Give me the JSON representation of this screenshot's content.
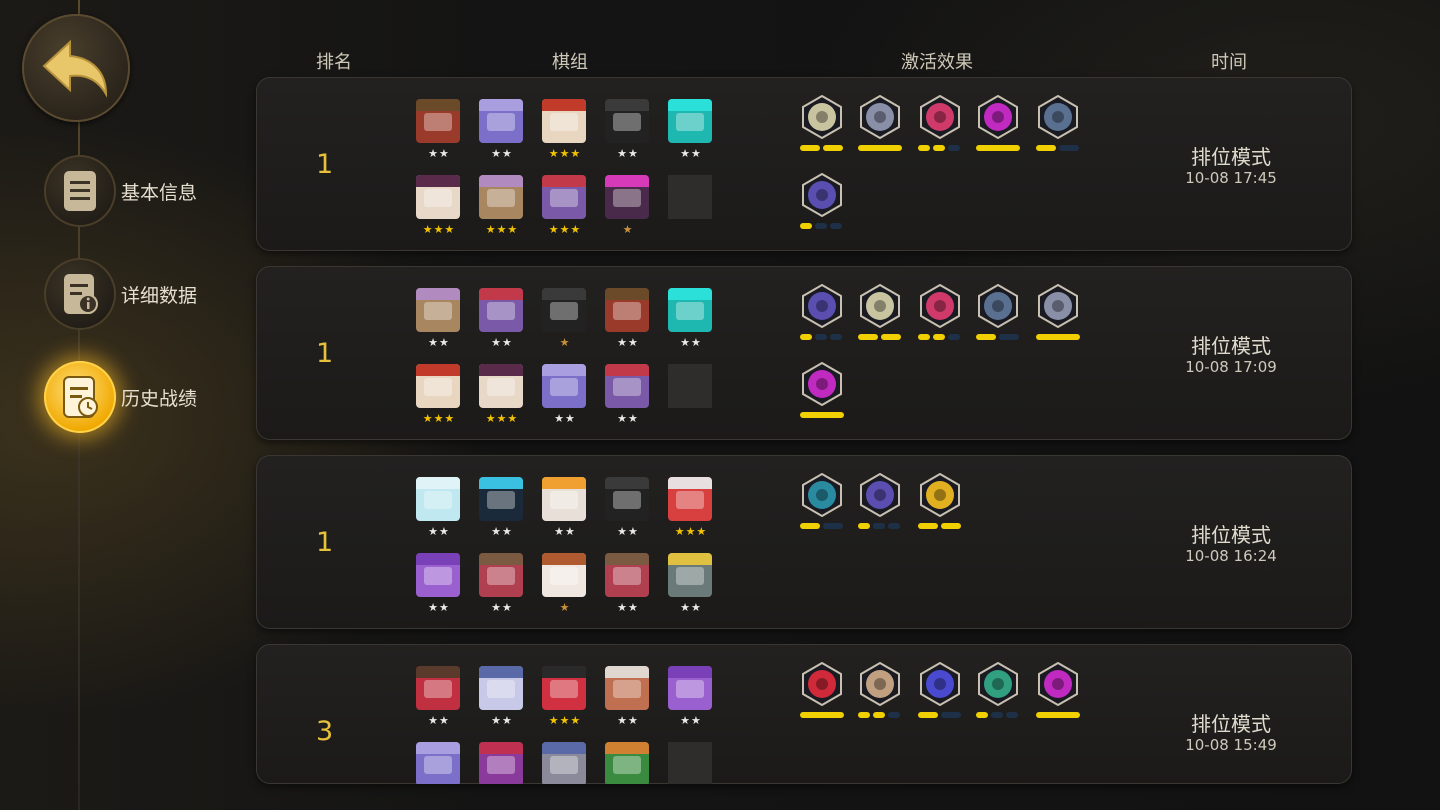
{
  "nav": {
    "items": [
      {
        "label": "基本信息",
        "icon": "document-icon",
        "active": false
      },
      {
        "label": "详细数据",
        "icon": "detail-data-icon",
        "active": false
      },
      {
        "label": "历史战绩",
        "icon": "history-record-icon",
        "active": true
      }
    ]
  },
  "headers": {
    "rank": "排名",
    "lineup": "棋组",
    "synergy": "激活效果",
    "time": "时间"
  },
  "records": [
    {
      "rank": "1",
      "mode": "排位模式",
      "time": "10-08 17:45",
      "units": [
        {
          "stars": "★★",
          "color": "#9a3a2a",
          "cap": "#6b4a2a"
        },
        {
          "stars": "★★",
          "color": "#7b6fc9",
          "cap": "#a99fe0"
        },
        {
          "stars": "★★★",
          "color": "#e8d6c0",
          "cap": "#c23a2a"
        },
        {
          "stars": "★★",
          "color": "#222222",
          "cap": "#3a3a3a"
        },
        {
          "stars": "★★",
          "color": "#1fb8b0",
          "cap": "#2ae0d8"
        },
        {
          "stars": "★★★",
          "color": "#e8d8c8",
          "cap": "#5a2a4a"
        },
        {
          "stars": "★★★",
          "color": "#a88660",
          "cap": "#b18ac0"
        },
        {
          "stars": "★★★",
          "color": "#7a5aa8",
          "cap": "#c23a4a"
        },
        {
          "stars": "★",
          "color": "#4a2a4a",
          "cap": "#d63ab8"
        },
        {
          "stars": "",
          "color": "",
          "cap": "",
          "empty": true
        }
      ],
      "synergies": [
        {
          "icon": "paw-crest-icon",
          "color": "#c9c4a0",
          "bars": [
            1,
            1
          ]
        },
        {
          "icon": "cross-icon",
          "color": "#8a8fa8",
          "bars": [
            2
          ]
        },
        {
          "icon": "knight-icon",
          "color": "#d03a6a",
          "bars": [
            1,
            1,
            0
          ]
        },
        {
          "icon": "demon-icon",
          "color": "#c02ac0",
          "bars": [
            2
          ]
        },
        {
          "icon": "scales-icon",
          "color": "#5a7090",
          "bars": [
            1,
            0
          ]
        },
        {
          "icon": "book-icon",
          "color": "#5a4fb0",
          "bars": [
            1,
            0,
            0
          ]
        }
      ]
    },
    {
      "rank": "1",
      "mode": "排位模式",
      "time": "10-08 17:09",
      "units": [
        {
          "stars": "★★",
          "color": "#a88660",
          "cap": "#b18ac0"
        },
        {
          "stars": "★★",
          "color": "#7a5aa8",
          "cap": "#c23a4a"
        },
        {
          "stars": "★",
          "color": "#222222",
          "cap": "#3a3a3a"
        },
        {
          "stars": "★★",
          "color": "#9a3a2a",
          "cap": "#6b4a2a"
        },
        {
          "stars": "★★",
          "color": "#1fb8b0",
          "cap": "#2ae0d8"
        },
        {
          "stars": "★★★",
          "color": "#e8d6c0",
          "cap": "#c23a2a"
        },
        {
          "stars": "★★★",
          "color": "#e8d8c8",
          "cap": "#5a2a4a"
        },
        {
          "stars": "★★",
          "color": "#7b6fc9",
          "cap": "#a99fe0"
        },
        {
          "stars": "★★",
          "color": "#7a5aa8",
          "cap": "#c23a4a"
        },
        {
          "stars": "",
          "color": "",
          "cap": "",
          "empty": true
        }
      ],
      "synergies": [
        {
          "icon": "book-icon",
          "color": "#5a4fb0",
          "bars": [
            1,
            0,
            0
          ]
        },
        {
          "icon": "paw-crest-icon",
          "color": "#c9c4a0",
          "bars": [
            1,
            1
          ]
        },
        {
          "icon": "knight-icon",
          "color": "#d03a6a",
          "bars": [
            1,
            1,
            0
          ]
        },
        {
          "icon": "scales-icon",
          "color": "#5a7090",
          "bars": [
            1,
            0
          ]
        },
        {
          "icon": "cross-icon",
          "color": "#8a8fa8",
          "bars": [
            2
          ]
        },
        {
          "icon": "demon-icon",
          "color": "#c02ac0",
          "bars": [
            2
          ]
        }
      ]
    },
    {
      "rank": "1",
      "mode": "排位模式",
      "time": "10-08 16:24",
      "units": [
        {
          "stars": "★★",
          "color": "#bfe8f0",
          "cap": "#e0f4f8"
        },
        {
          "stars": "★★",
          "color": "#1a2a3a",
          "cap": "#3ac0e0"
        },
        {
          "stars": "★★",
          "color": "#e8e0d8",
          "cap": "#f0a030"
        },
        {
          "stars": "★★",
          "color": "#222222",
          "cap": "#3a3a3a"
        },
        {
          "stars": "★★★",
          "color": "#d84040",
          "cap": "#e8e0e0"
        },
        {
          "stars": "★★",
          "color": "#9a60d0",
          "cap": "#7a40b8"
        },
        {
          "stars": "★★",
          "color": "#b04050",
          "cap": "#7a5a40"
        },
        {
          "stars": "★",
          "color": "#f0e8e0",
          "cap": "#b05a30"
        },
        {
          "stars": "★★",
          "color": "#b04050",
          "cap": "#7a5a40"
        },
        {
          "stars": "★★",
          "color": "#6a7a78",
          "cap": "#e0c040"
        }
      ],
      "synergies": [
        {
          "icon": "question-icon",
          "color": "#2a8aa0",
          "bars": [
            1,
            0
          ]
        },
        {
          "icon": "book-icon",
          "color": "#5a4fb0",
          "bars": [
            1,
            0,
            0
          ]
        },
        {
          "icon": "ring-icon",
          "color": "#e0b020",
          "bars": [
            1,
            1
          ]
        }
      ]
    },
    {
      "rank": "3",
      "mode": "排位模式",
      "time": "10-08 15:49",
      "units": [
        {
          "stars": "★★",
          "color": "#c03040",
          "cap": "#5a3a2a"
        },
        {
          "stars": "★★",
          "color": "#c8c8e8",
          "cap": "#5a6aa8"
        },
        {
          "stars": "★★★",
          "color": "#d03040",
          "cap": "#2a2a2a"
        },
        {
          "stars": "★★",
          "color": "#c07050",
          "cap": "#e0d8d0"
        },
        {
          "stars": "★★",
          "color": "#9a60d0",
          "cap": "#7a40b8"
        },
        {
          "stars": "",
          "color": "#7b6fc9",
          "cap": "#a99fe0"
        },
        {
          "stars": "",
          "color": "#8a3a9a",
          "cap": "#c03050"
        },
        {
          "stars": "",
          "color": "#8a8a9a",
          "cap": "#5a6aa8"
        },
        {
          "stars": "",
          "color": "#3a8a40",
          "cap": "#d08030"
        },
        {
          "stars": "",
          "color": "",
          "cap": "",
          "empty": true
        }
      ],
      "synergies": [
        {
          "icon": "arch-icon",
          "color": "#d02a3a",
          "bars": [
            2
          ]
        },
        {
          "icon": "axe-icon",
          "color": "#c0a080",
          "bars": [
            1,
            1,
            0
          ]
        },
        {
          "icon": "fishbone-icon",
          "color": "#4a4ad0",
          "bars": [
            1,
            0
          ]
        },
        {
          "icon": "paw-print-icon",
          "color": "#30a080",
          "bars": [
            1,
            0,
            0
          ]
        },
        {
          "icon": "demon-icon",
          "color": "#c02ac0",
          "bars": [
            2
          ]
        }
      ]
    }
  ]
}
